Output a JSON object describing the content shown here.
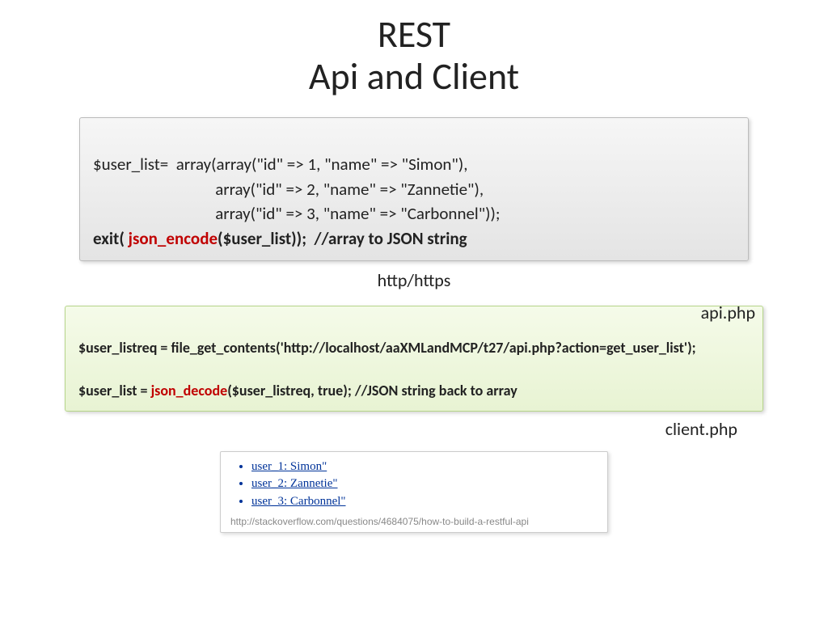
{
  "title_line1": "REST",
  "title_line2": "Api and Client",
  "code1": {
    "p1": "$user_list=  array(array(\"id\" => 1, \"name\" => \"Simon\"),",
    "p2": "array(\"id\" => 2, \"name\" => \"Zannetie\"),",
    "p3": "array(\"id\" => 3, \"name\" => \"Carbonnel\"));",
    "exit_pre": "exit(",
    "json_enc": " json_encode",
    "exit_post": "($user_list));  //array to JSON string"
  },
  "labels": {
    "http": "http/https",
    "api": "api.php",
    "client": "client.php"
  },
  "code2": {
    "l1": "$user_listreq = file_get_contents('http://localhost/aaXMLandMCP/t27/api.php?action=get_user_list');",
    "l2a": "$user_list = ",
    "l2b": "json_decode",
    "l2c": "($user_listreq, true); //JSON string back to array"
  },
  "result": {
    "items": [
      "user_1: Simon\"",
      "user_2: Zannetie\"",
      "user_3: Carbonnel\""
    ],
    "source": "http://stackoverflow.com/questions/4684075/how-to-build-a-restful-api"
  }
}
